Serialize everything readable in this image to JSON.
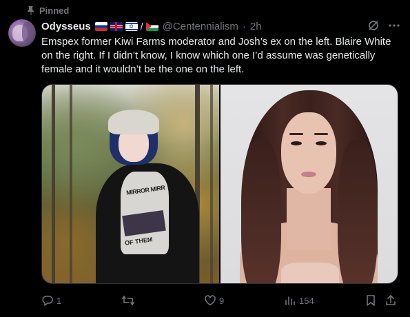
{
  "pinned": {
    "label": "Pinned"
  },
  "tweet": {
    "author_name": "Odysseus",
    "handle": "@Centennialism",
    "separator": "·",
    "time": "2h",
    "flag_separator": "/",
    "text": "Emspex former Kiwi Farms moderator and Josh’s ex on the left. Blaire White on the right. If I didn’t know, I know which one I’d assume was genetically female and it wouldn’t be the one on the left.",
    "flags": [
      "flag-russia-icon",
      "flag-uk-icon",
      "flag-israel-icon",
      "flag-palestine-icon"
    ]
  },
  "media": {
    "left_shirt_text_1": "MIRROR MIRR",
    "left_shirt_text_2": "OF THEM"
  },
  "actions": {
    "replies": "1",
    "reposts": "",
    "likes": "9",
    "views": "154"
  },
  "colors": {
    "background": "#000000",
    "text_primary": "#e7e9ea",
    "text_secondary": "#71767b",
    "border": "#2f3336"
  }
}
